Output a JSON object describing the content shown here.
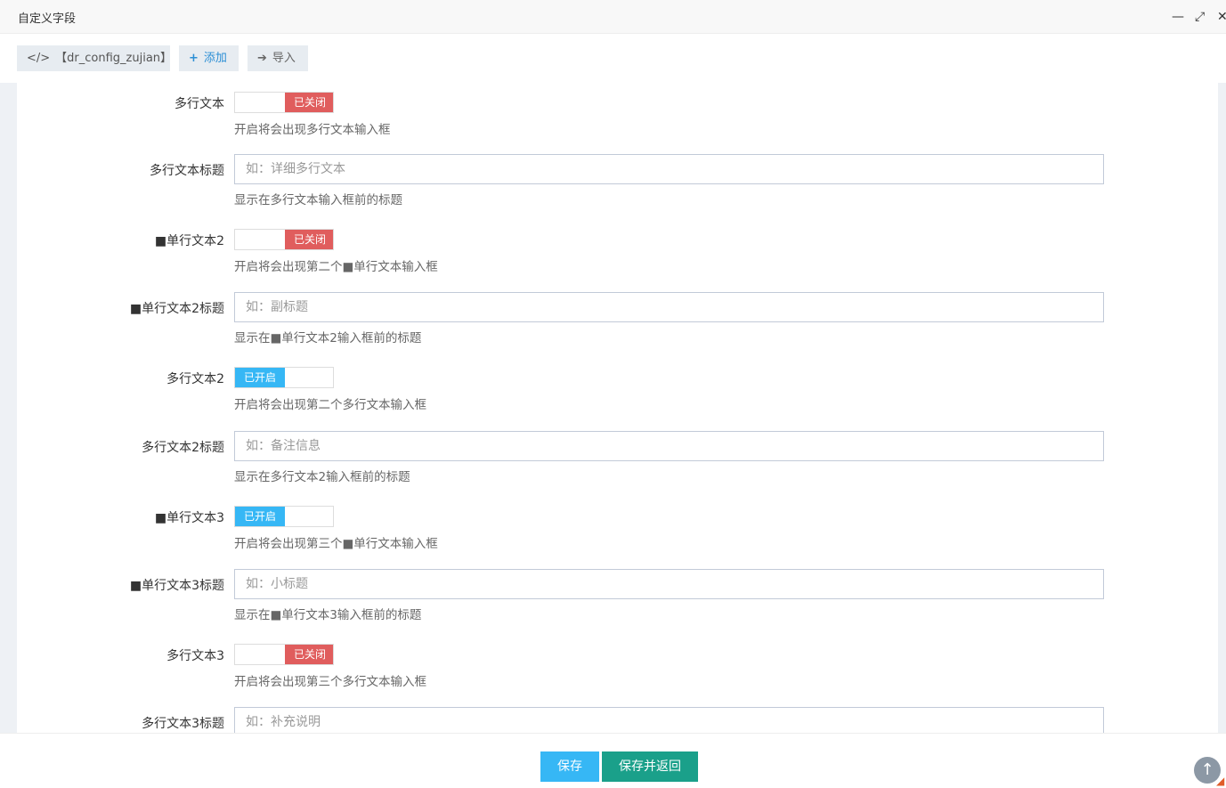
{
  "window": {
    "title": "自定义字段",
    "minimize_icon": "—",
    "maximize_icon": "⤢",
    "close_icon": "✕"
  },
  "toolbar": {
    "code_label": "【dr_config_zujian】",
    "add_label": "添加",
    "import_label": "导入"
  },
  "fields": [
    {
      "label": "多行文本",
      "type": "switch",
      "state": "closed",
      "state_label": "已关闭",
      "help": "开启将会出现多行文本输入框"
    },
    {
      "label": "多行文本标题",
      "type": "input",
      "placeholder": "如：详细多行文本",
      "help": "显示在多行文本输入框前的标题"
    },
    {
      "label": "■单行文本2",
      "type": "switch",
      "state": "closed",
      "state_label": "已关闭",
      "help": "开启将会出现第二个■单行文本输入框"
    },
    {
      "label": "■单行文本2标题",
      "type": "input",
      "placeholder": "如：副标题",
      "help": "显示在■单行文本2输入框前的标题"
    },
    {
      "label": "多行文本2",
      "type": "switch",
      "state": "opened",
      "state_label": "已开启",
      "help": "开启将会出现第二个多行文本输入框"
    },
    {
      "label": "多行文本2标题",
      "type": "input",
      "placeholder": "如：备注信息",
      "help": "显示在多行文本2输入框前的标题"
    },
    {
      "label": "■单行文本3",
      "type": "switch",
      "state": "opened",
      "state_label": "已开启",
      "help": "开启将会出现第三个■单行文本输入框"
    },
    {
      "label": "■单行文本3标题",
      "type": "input",
      "placeholder": "如：小标题",
      "help": "显示在■单行文本3输入框前的标题"
    },
    {
      "label": "多行文本3",
      "type": "switch",
      "state": "closed",
      "state_label": "已关闭",
      "help": "开启将会出现第三个多行文本输入框"
    },
    {
      "label": "多行文本3标题",
      "type": "input",
      "placeholder": "如：补充说明",
      "help": ""
    }
  ],
  "footer": {
    "save_label": "保存",
    "save_back_label": "保存并返回"
  },
  "colors": {
    "switch_closed": "#e05d5d",
    "switch_open": "#36b7f5",
    "save_button": "#36b7f5",
    "save_back_button": "#1aa08a"
  }
}
